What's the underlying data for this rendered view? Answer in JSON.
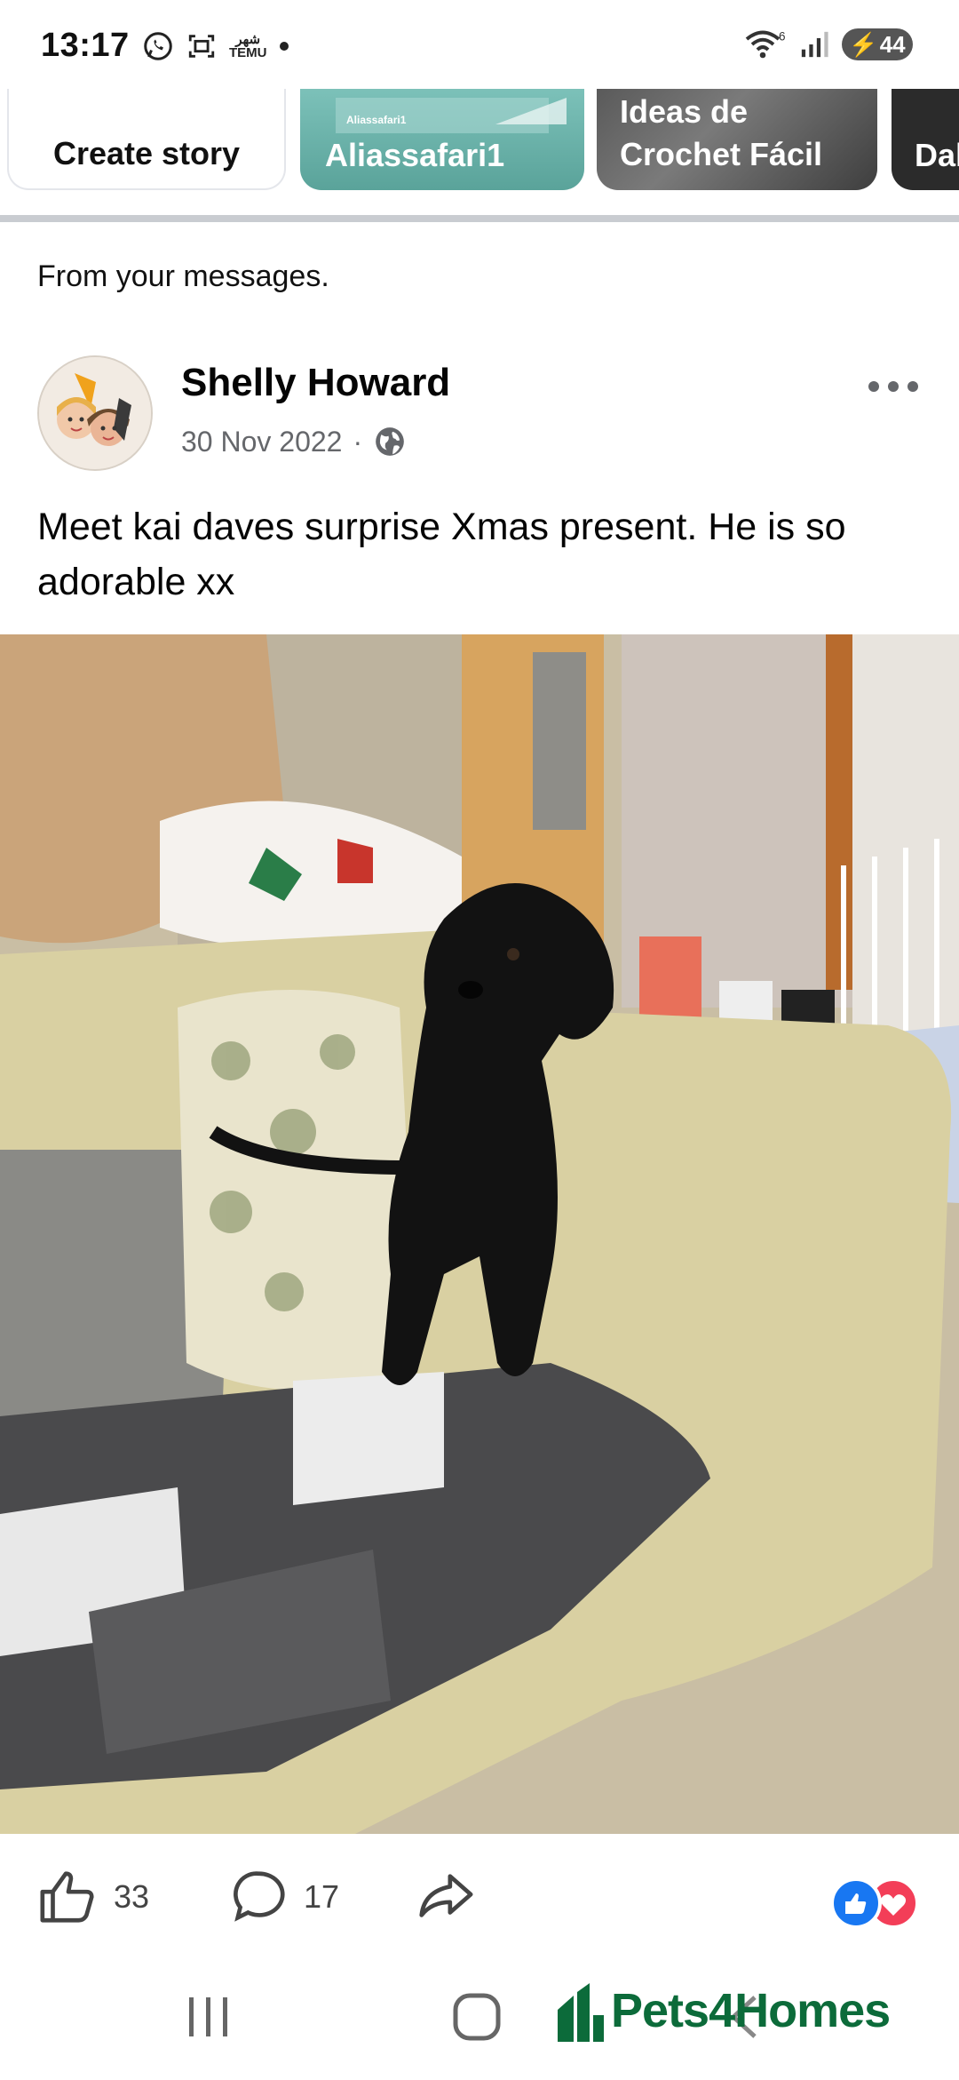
{
  "status_bar": {
    "time": "13:17",
    "temu_label_top": "شهر",
    "temu_label_bottom": "TEMU",
    "battery": "44",
    "wifi_badge": "6"
  },
  "stories": [
    {
      "label": "Create story"
    },
    {
      "label": "Aliassafari1",
      "overlay_text": "Aliassafari1"
    },
    {
      "label": "Ideas de Crochet Fácil"
    },
    {
      "label": "Dal"
    }
  ],
  "section_label": "From your messages.",
  "post": {
    "author": "Shelly Howard",
    "date": "30 Nov 2022",
    "separator": "·",
    "privacy_icon": "globe-icon",
    "text": "Meet kai daves surprise Xmas present. He is so adorable xx",
    "likes": "33",
    "comments": "17"
  },
  "watermark": "Pets4Homes",
  "colors": {
    "like_blue": "#1877f2",
    "love_red": "#f33e58",
    "brand_green": "#0c6b3a",
    "divider": "#c9ccd1"
  }
}
